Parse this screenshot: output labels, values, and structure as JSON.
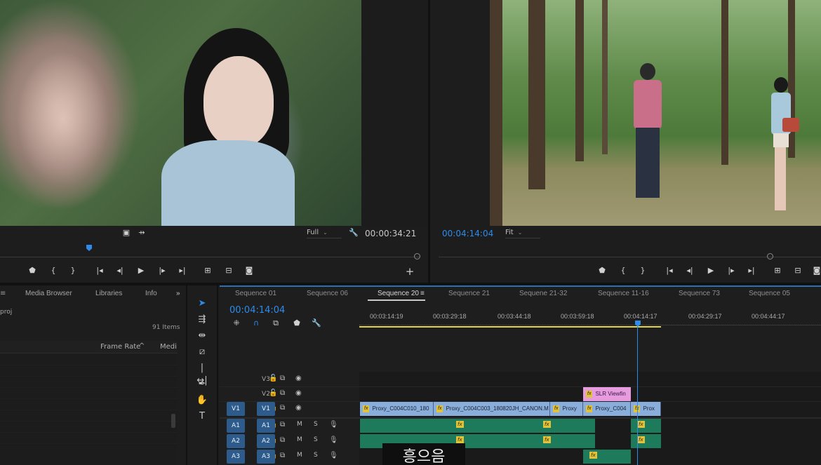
{
  "source_monitor": {
    "fit_label": "Full",
    "timecode": "00:00:34:21"
  },
  "program_monitor": {
    "timecode": "00:04:14:04",
    "fit_label": "Fit"
  },
  "project_panel": {
    "tabs": [
      "Media Browser",
      "Libraries",
      "Info"
    ],
    "more_icon": "double-chevron-right",
    "project_name_partial": "proj",
    "item_count": "91 Items",
    "column_frame_rate": "Frame Rate",
    "column_media": "Medi"
  },
  "tools": [
    "selection-tool",
    "track-select-tool",
    "ripple-edit-tool",
    "razor-tool",
    "slip-tool",
    "pen-tool",
    "hand-tool",
    "type-tool"
  ],
  "timeline": {
    "sequences": [
      "Sequence 01",
      "Sequence 06",
      "Sequence 20",
      "Sequence 21",
      "Sequene 21-32",
      "Sequence 11-16",
      "Sequence 73",
      "Sequence 05"
    ],
    "active_sequence": "Sequence 20",
    "playhead_timecode": "00:04:14:04",
    "ruler_times": [
      "00:03:14:19",
      "00:03:29:18",
      "00:03:44:18",
      "00:03:59:18",
      "00:04:14:17",
      "00:04:29:17",
      "00:04:44:17"
    ],
    "video_tracks": [
      "V3",
      "V2",
      "V1"
    ],
    "audio_tracks": [
      "A1",
      "A2",
      "A3"
    ],
    "audio_solo_mute": [
      "M",
      "S"
    ],
    "clips_v1": [
      "Proxy_C004C010_180",
      "Proxy_C004C003_180820JH_CANON.M",
      "Proxy",
      "Proxy_C004",
      "Prox"
    ],
    "clip_v2": "SLR Viewfin",
    "fx_badge": "fx"
  },
  "subtitle_text": "흥으음",
  "colors": {
    "accent_blue": "#2d8ceb",
    "video_clip": "#8aaedc",
    "audio_clip": "#1d7b5b",
    "fx_badge": "#e1c33b",
    "adjustment_clip": "#e79ce0"
  }
}
